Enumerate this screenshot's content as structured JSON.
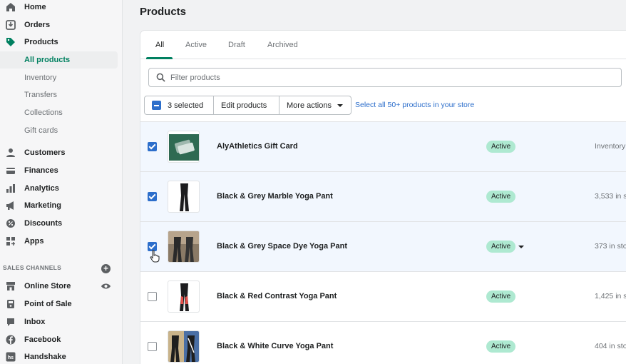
{
  "sidebar": {
    "nav": [
      {
        "label": "Home",
        "icon": "home-icon"
      },
      {
        "label": "Orders",
        "icon": "orders-icon"
      },
      {
        "label": "Products",
        "icon": "tag-icon"
      }
    ],
    "products_sub": [
      {
        "label": "All products",
        "active": true
      },
      {
        "label": "Inventory"
      },
      {
        "label": "Transfers"
      },
      {
        "label": "Collections"
      },
      {
        "label": "Gift cards"
      }
    ],
    "nav2": [
      {
        "label": "Customers",
        "icon": "customers-icon"
      },
      {
        "label": "Finances",
        "icon": "finances-icon"
      },
      {
        "label": "Analytics",
        "icon": "analytics-icon"
      },
      {
        "label": "Marketing",
        "icon": "megaphone-icon"
      },
      {
        "label": "Discounts",
        "icon": "discount-icon"
      },
      {
        "label": "Apps",
        "icon": "apps-icon"
      }
    ],
    "sales_channels_header": "SALES CHANNELS",
    "channels": [
      {
        "label": "Online Store",
        "icon": "store-icon"
      },
      {
        "label": "Point of Sale",
        "icon": "pos-icon"
      },
      {
        "label": "Inbox",
        "icon": "inbox-icon"
      },
      {
        "label": "Facebook",
        "icon": "facebook-icon"
      },
      {
        "label": "Handshake",
        "icon": "handshake-icon"
      }
    ]
  },
  "page": {
    "title": "Products"
  },
  "tabs": [
    "All",
    "Active",
    "Draft",
    "Archived"
  ],
  "filter": {
    "placeholder": "Filter products"
  },
  "bulk": {
    "selected_label": "3 selected",
    "edit_label": "Edit products",
    "more_label": "More actions",
    "select_all_link": "Select all 50+ products in your store"
  },
  "products": [
    {
      "name": "AlyAthletics Gift Card",
      "status": "Active",
      "inventory": "Inventory",
      "selected": true
    },
    {
      "name": "Black & Grey Marble Yoga Pant",
      "status": "Active",
      "inventory": "3,533 in s",
      "selected": true
    },
    {
      "name": "Black & Grey Space Dye Yoga Pant",
      "status": "Active",
      "inventory": "373 in sto",
      "selected": true
    },
    {
      "name": "Black & Red Contrast Yoga Pant",
      "status": "Active",
      "inventory": "1,425 in s",
      "selected": false
    },
    {
      "name": "Black & White Curve Yoga Pant",
      "status": "Active",
      "inventory": "404 in sto",
      "selected": false
    }
  ],
  "colors": {
    "accent": "#008060",
    "selected_row": "#f2f7fe",
    "checkbox": "#2c6ecb",
    "badge": "#aee9d1"
  }
}
